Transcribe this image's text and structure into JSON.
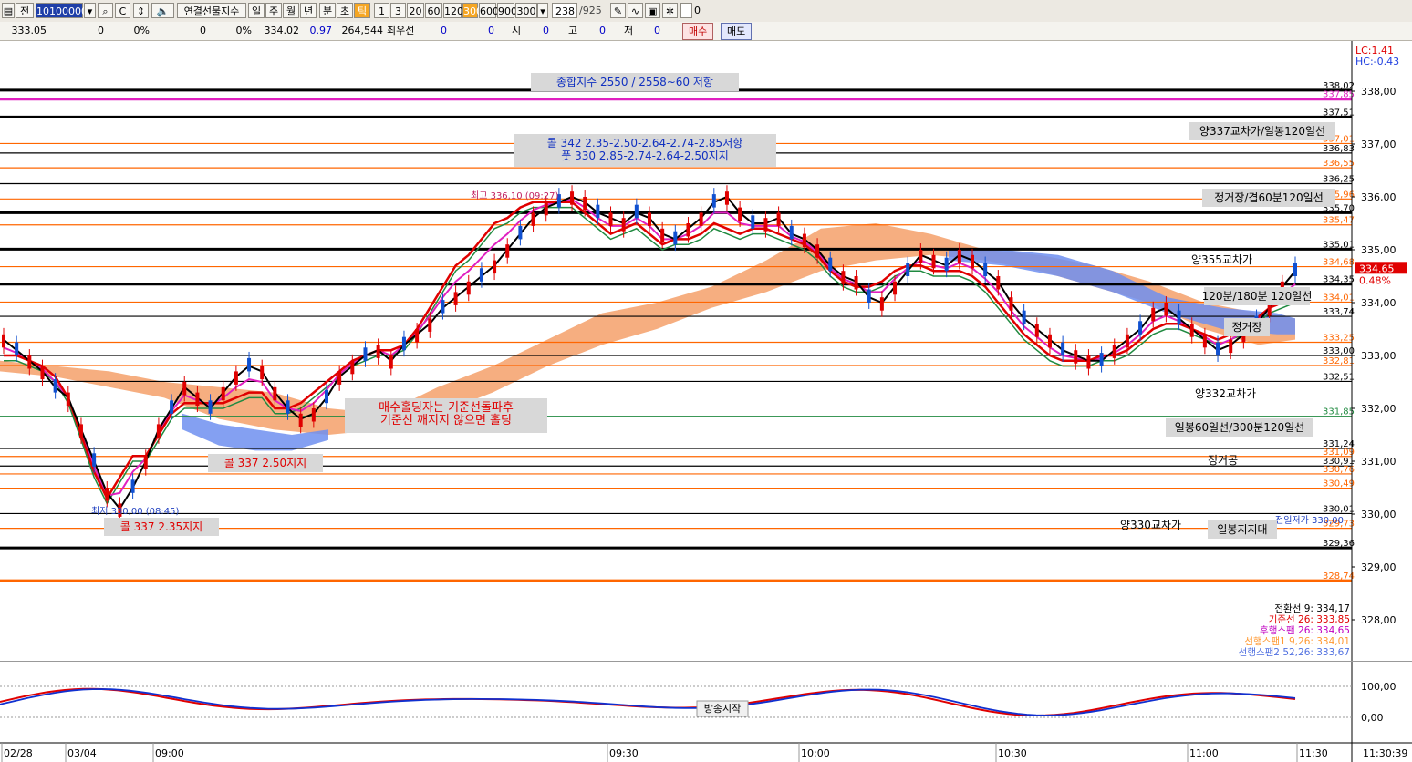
{
  "toolbar": {
    "tab_label": "전",
    "code": "101000000",
    "symbol_name": "연결선물지수",
    "periods": [
      "일",
      "주",
      "월",
      "년",
      "분",
      "초",
      "틱"
    ],
    "active_period": "틱",
    "intervals": [
      "1",
      "3",
      "20",
      "60",
      "120",
      "300",
      "600",
      "900"
    ],
    "active_interval": "300",
    "interval_value": "300",
    "count": "238",
    "count_total": "/925"
  },
  "quote": {
    "price": "333.05",
    "v1": "0",
    "v1p": "0%",
    "v2": "0",
    "v2p": "0%",
    "last": "334.02",
    "change": "0.97",
    "volume": "264,544",
    "best_label": "최우선",
    "best_v1": "0",
    "best_v2": "0",
    "open_label": "시",
    "open_v": "0",
    "high_label": "고",
    "high_v": "0",
    "low_label": "저",
    "low_v": "0",
    "buy_label": "매수",
    "sell_label": "매도"
  },
  "chart_data": {
    "type": "line",
    "ylim": [
      327.6,
      338.4
    ],
    "yticks": [
      "338,00",
      "337,00",
      "336,00",
      "335,00",
      "334,00",
      "333,00",
      "332,00",
      "331,00",
      "330,00",
      "329,00",
      "328,00"
    ],
    "ytick_values": [
      338,
      337,
      336,
      335,
      334,
      333,
      332,
      331,
      330,
      329,
      328
    ],
    "xticks": [
      "02/28",
      "03/04",
      "09:00",
      "09:30",
      "10:00",
      "10:30",
      "11:00",
      "11:30"
    ],
    "last_time": "11:30:39",
    "lc_label": "LC:1.41",
    "hc_label": "HC:-0.43",
    "current_price": "334.65",
    "current_pct": "0.48%",
    "sub_yticks": [
      "100,00",
      "0,00"
    ],
    "colors": {
      "black_line": "#000000",
      "orange_line": "#ff6600",
      "magenta_line": "#e020c0",
      "green_line": "#208a40",
      "cloud_up": "#f4a06a",
      "cloud_down": "#6f8ff0",
      "candle_up": "#e00000",
      "candle_down": "#1050d0"
    },
    "levels": [
      {
        "value": 338.02,
        "label": "338,02",
        "color": "#000000",
        "bold": true
      },
      {
        "value": 337.85,
        "label": "337,85",
        "color": "#e020c0",
        "bold": true
      },
      {
        "value": 337.51,
        "label": "337,51",
        "color": "#000000",
        "bold": true
      },
      {
        "value": 337.01,
        "label": "337,01",
        "color": "#ff6600",
        "bold": false
      },
      {
        "value": 336.83,
        "label": "336,83",
        "color": "#000000",
        "bold": false
      },
      {
        "value": 336.55,
        "label": "336,55",
        "color": "#ff6600",
        "bold": false
      },
      {
        "value": 336.25,
        "label": "336,25",
        "color": "#000000",
        "bold": false
      },
      {
        "value": 335.96,
        "label": "335,96",
        "color": "#ff6600",
        "bold": false
      },
      {
        "value": 335.7,
        "label": "335,70",
        "color": "#000000",
        "bold": true
      },
      {
        "value": 335.47,
        "label": "335,47",
        "color": "#ff6600",
        "bold": false
      },
      {
        "value": 335.01,
        "label": "335,01",
        "color": "#000000",
        "bold": true
      },
      {
        "value": 334.68,
        "label": "334,68",
        "color": "#ff6600",
        "bold": false
      },
      {
        "value": 334.35,
        "label": "334,35",
        "color": "#000000",
        "bold": true
      },
      {
        "value": 334.01,
        "label": "334,01",
        "color": "#ff6600",
        "bold": false
      },
      {
        "value": 333.74,
        "label": "333,74",
        "color": "#000000",
        "bold": false
      },
      {
        "value": 333.25,
        "label": "333,25",
        "color": "#ff6600",
        "bold": false
      },
      {
        "value": 333.0,
        "label": "333,00",
        "color": "#000000",
        "bold": false
      },
      {
        "value": 332.81,
        "label": "332,81",
        "color": "#ff6600",
        "bold": false
      },
      {
        "value": 332.51,
        "label": "332,51",
        "color": "#000000",
        "bold": false
      },
      {
        "value": 331.85,
        "label": "331,85",
        "color": "#208a40",
        "bold": false
      },
      {
        "value": 331.24,
        "label": "331,24",
        "color": "#000000",
        "bold": false
      },
      {
        "value": 331.09,
        "label": "331,09",
        "color": "#ff6600",
        "bold": false
      },
      {
        "value": 330.91,
        "label": "330,91",
        "color": "#000000",
        "bold": false
      },
      {
        "value": 330.76,
        "label": "330,76",
        "color": "#ff6600",
        "bold": false
      },
      {
        "value": 330.49,
        "label": "330,49",
        "color": "#ff6600",
        "bold": false
      },
      {
        "value": 330.01,
        "label": "330,01",
        "color": "#000000",
        "bold": false
      },
      {
        "value": 329.73,
        "label": "329,73",
        "color": "#ff6600",
        "bold": false
      },
      {
        "value": 329.36,
        "label": "329,36",
        "color": "#000000",
        "bold": true
      },
      {
        "value": 328.74,
        "label": "328,74",
        "color": "#ff6600",
        "bold": true
      }
    ],
    "annotations": {
      "index_resist": "종합지수 2550 / 2558~60 저항",
      "call_resist": "콜 342 2.35-2.50-2.64-2.74-2.85저항",
      "put_support": "풋 330 2.85-2.74-2.64-2.50지지",
      "hold_line1": "매수홀딩자는 기준선돌파후",
      "hold_line2": "기준선 깨지지 않으면 홀딩",
      "call_250": "콜 337 2.50지지",
      "call_235": "콜 337 2.35지지",
      "high_mark": "최고 336,10 (09:27)",
      "low_mark": "최저 330,00 (08:45)",
      "prev_low": "전일저가 330,00",
      "r1": "양337교차가/일봉120일선",
      "r2": "정거장/겹60분120일선",
      "r3": "양355교차가",
      "r4": "120분/180분 120일선",
      "r5": "정거장",
      "r6": "양332교차가",
      "r7": "일봉60일선/300분120일선",
      "r8": "정거공",
      "r9": "양330교차가",
      "r10": "일봉지지대",
      "broadcast": "방송시작"
    },
    "legend": [
      {
        "label": "전환선 9: 334,17",
        "color": "#000000"
      },
      {
        "label": "기준선 26: 333,85",
        "color": "#e00000"
      },
      {
        "label": "후행스팬 26: 334,65",
        "color": "#c000c0"
      },
      {
        "label": "선행스팬1 9,26: 334,01",
        "color": "#ff9933"
      },
      {
        "label": "선행스팬2 52,26: 333,67",
        "color": "#5070e0"
      }
    ],
    "series": [
      {
        "values": [
          333.3,
          333.1,
          332.9,
          332.7,
          332.4,
          332.2,
          331.6,
          331.0,
          330.4,
          330.1,
          330.5,
          331.0,
          331.6,
          332.0,
          332.4,
          332.2,
          332.0,
          332.3,
          332.6,
          332.8,
          332.7,
          332.3,
          332.0,
          331.8,
          331.9,
          332.2,
          332.6,
          332.8,
          333.0,
          333.1,
          332.9,
          333.2,
          333.4,
          333.6,
          333.9,
          334.1,
          334.3,
          334.5,
          334.7,
          335.0,
          335.3,
          335.6,
          335.8,
          335.9,
          336.0,
          335.9,
          335.7,
          335.6,
          335.5,
          335.7,
          335.6,
          335.3,
          335.2,
          335.4,
          335.6,
          335.9,
          336.0,
          335.7,
          335.5,
          335.5,
          335.6,
          335.3,
          335.2,
          335.0,
          334.7,
          334.5,
          334.4,
          334.1,
          334.0,
          334.3,
          334.6,
          334.9,
          334.8,
          334.7,
          334.9,
          334.8,
          334.6,
          334.4,
          334.0,
          333.7,
          333.5,
          333.3,
          333.1,
          333.0,
          332.9,
          332.9,
          333.1,
          333.3,
          333.5,
          333.8,
          333.9,
          333.7,
          333.5,
          333.3,
          333.1,
          333.2,
          333.4,
          333.6,
          333.9,
          334.3,
          334.6
        ]
      },
      {
        "values": [
          333.0,
          333.0,
          332.9,
          332.8,
          332.6,
          332.2,
          331.5,
          330.8,
          330.3,
          330.7,
          331.1,
          331.1,
          331.5,
          331.9,
          332.1,
          332.1,
          332.1,
          332.1,
          332.2,
          332.3,
          332.3,
          332.0,
          332.0,
          332.1,
          332.3,
          332.5,
          332.7,
          332.9,
          333.0,
          333.1,
          333.1,
          333.2,
          333.5,
          333.9,
          334.3,
          334.7,
          334.9,
          335.2,
          335.5,
          335.6,
          335.8,
          335.9,
          335.9,
          335.9,
          335.9,
          335.7,
          335.5,
          335.3,
          335.4,
          335.5,
          335.3,
          335.1,
          335.2,
          335.2,
          335.3,
          335.5,
          335.4,
          335.3,
          335.4,
          335.4,
          335.3,
          335.2,
          335.1,
          334.9,
          334.6,
          334.4,
          334.3,
          334.3,
          334.4,
          334.6,
          334.7,
          334.7,
          334.6,
          334.6,
          334.6,
          334.5,
          334.3,
          334.0,
          333.7,
          333.4,
          333.2,
          333.0,
          332.9,
          332.9,
          332.9,
          333.0,
          333.0,
          333.1,
          333.3,
          333.5,
          333.6,
          333.6,
          333.5,
          333.4,
          333.3,
          333.4,
          333.5,
          333.7,
          333.9,
          334.0,
          334.1
        ]
      }
    ]
  }
}
